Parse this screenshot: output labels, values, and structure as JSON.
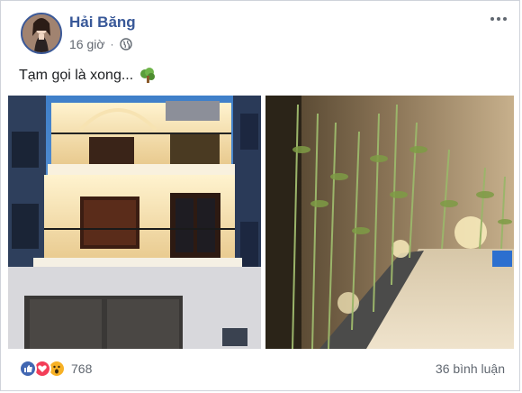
{
  "post": {
    "author_name": "Hải Băng",
    "timestamp": "16 giờ",
    "text": "Tạm gọi là xong...",
    "text_emoji": "tree-emoji",
    "privacy_icon": "globe-icon"
  },
  "photos": [
    {
      "subject": "house-facade-photo"
    },
    {
      "subject": "bamboo-garden-photo"
    }
  ],
  "footer": {
    "reaction_count": "768",
    "reaction_icons": [
      "like-icon",
      "love-icon",
      "wow-icon"
    ],
    "comments_label": "36 bình luận"
  },
  "colors": {
    "brand_blue": "#385898",
    "like_blue": "#4267b2",
    "love_red": "#f33e58",
    "wow_yellow": "#f7b125",
    "meta_gray": "#616770"
  }
}
